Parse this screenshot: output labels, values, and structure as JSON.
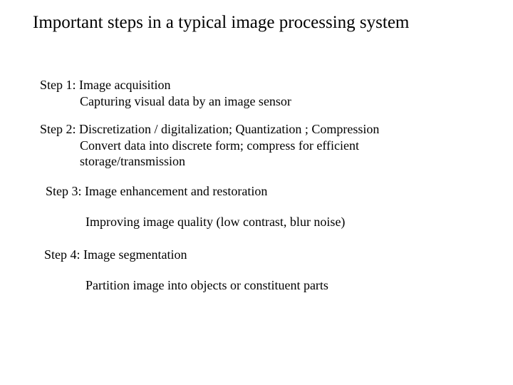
{
  "title": "Important steps in a typical image processing system",
  "steps": [
    {
      "heading": "Step 1: Image acquisition",
      "desc": "Capturing visual data by an image sensor"
    },
    {
      "heading": "Step 2: Discretization / digitalization; Quantization ; Compression",
      "desc1": "Convert data into discrete form; compress for efficient",
      "desc2": "storage/transmission"
    },
    {
      "heading": "Step 3: Image enhancement and restoration",
      "desc": "Improving image quality (low contrast, blur noise)"
    },
    {
      "heading": "Step 4: Image segmentation",
      "desc": "Partition image into objects or constituent parts"
    }
  ]
}
